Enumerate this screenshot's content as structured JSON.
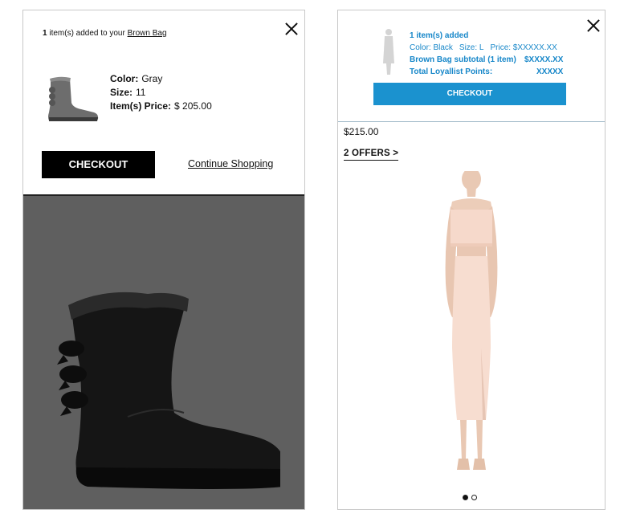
{
  "left_screen": {
    "confirmation": {
      "count": "1",
      "message": " item(s) added to your ",
      "bag_link": "Brown Bag"
    },
    "product": {
      "image_icon": "gray-boot-thumbnail",
      "color_label": "Color:",
      "color_value": "Gray",
      "size_label": "Size:",
      "size_value": "11",
      "price_label": "Item(s) Price:",
      "price_value": "$ 205.00"
    },
    "checkout_label": "CHECKOUT",
    "continue_label": "Continue Shopping",
    "overlay_color": "#5f5f5f",
    "background_image_icon": "black-boot-image"
  },
  "right_screen": {
    "mini_cart": {
      "silhouette_icon": "model-silhouette",
      "added": "1 item(s) added",
      "color_label": "Color: Black",
      "size_label": "Size: L",
      "price_label": "Price: $XXXXX.XX",
      "subtotal_label": "Brown Bag subtotal (1 item)",
      "subtotal_value": "$XXXX.XX",
      "points_label": "Total Loyallist Points:",
      "points_value": "XXXXX",
      "checkout_label": "CHECKOUT",
      "accent_color": "#1b92cf"
    },
    "price": "$215.00",
    "offers_label": "2 OFFERS",
    "offers_chevron": ">",
    "carousel": {
      "current": 1,
      "total": 2
    },
    "product_image_icon": "model-in-blush-dress"
  }
}
